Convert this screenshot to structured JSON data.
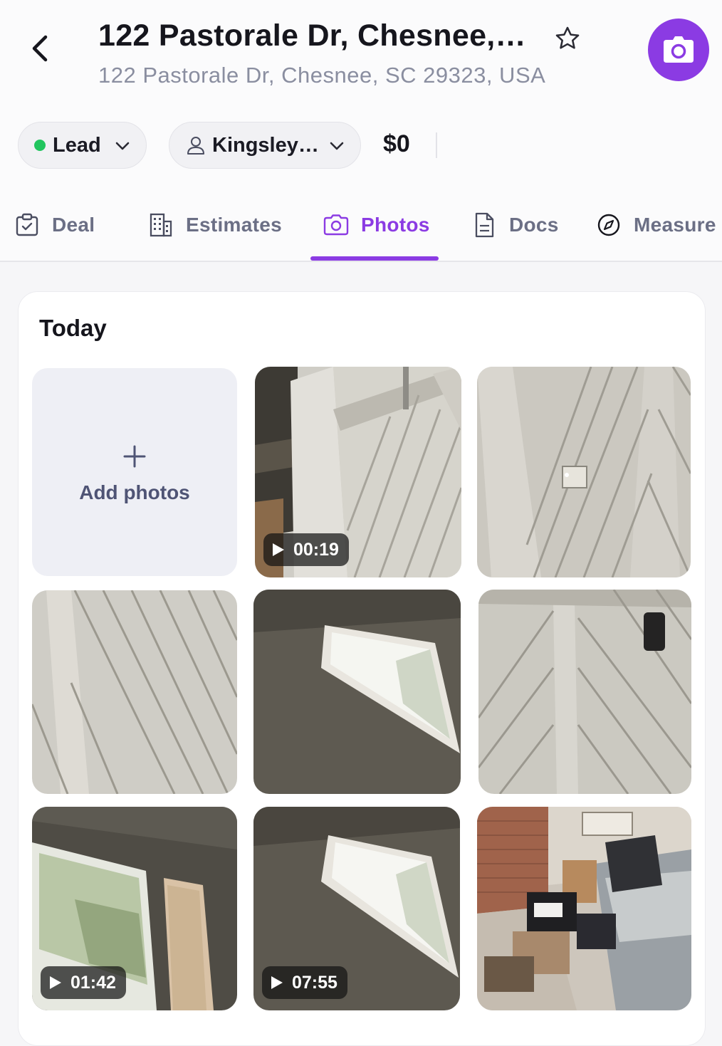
{
  "header": {
    "title": "122 Pastorale Dr, Chesnee,…",
    "subtitle": "122 Pastorale Dr, Chesnee, SC 29323, USA",
    "icons": {
      "back": "chevron-left-icon",
      "favorite": "star-outline-icon",
      "camera": "camera-icon"
    },
    "accent_color": "#8b3be3"
  },
  "status_bar": {
    "status": {
      "label": "Lead",
      "dot_color": "#22c55e"
    },
    "assignee": {
      "label": "Kingsley…"
    },
    "amount": "$0"
  },
  "tabs": [
    {
      "label": "Deal",
      "icon": "clipboard-icon",
      "active": false
    },
    {
      "label": "Estimates",
      "icon": "building-icon",
      "active": false
    },
    {
      "label": "Photos",
      "icon": "camera-icon",
      "active": true
    },
    {
      "label": "Docs",
      "icon": "document-icon",
      "active": false
    },
    {
      "label": "Measure",
      "icon": "compass-icon",
      "active": false
    }
  ],
  "gallery": {
    "section_title": "Today",
    "add_label": "Add photos",
    "items": [
      {
        "kind": "video",
        "scene": "wall-corner-diagonal-panels",
        "duration": "00:19"
      },
      {
        "kind": "photo",
        "scene": "diagonal-panels-outlet"
      },
      {
        "kind": "photo",
        "scene": "diagonal-panels-close"
      },
      {
        "kind": "photo",
        "scene": "trapezoid-window"
      },
      {
        "kind": "photo",
        "scene": "diagonal-panels-device"
      },
      {
        "kind": "video",
        "scene": "slanted-window-curtain",
        "duration": "01:42"
      },
      {
        "kind": "video",
        "scene": "trapezoid-window",
        "duration": "07:55"
      },
      {
        "kind": "photo",
        "scene": "room-with-boxes-bed"
      }
    ]
  }
}
